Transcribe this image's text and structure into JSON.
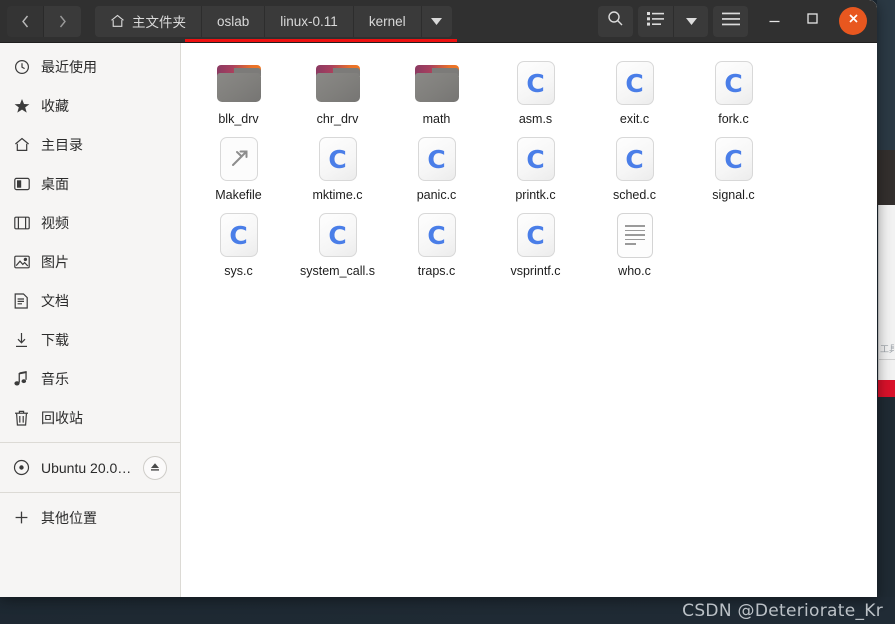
{
  "window": {
    "titlebar": {
      "back_label": "后退",
      "forward_label": "前进",
      "path_buttons": [
        {
          "label": "主文件夹",
          "icon": "home-icon",
          "has_home_icon": true
        },
        {
          "label": "oslab",
          "icon": "",
          "has_home_icon": false
        },
        {
          "label": "linux-0.11",
          "icon": "",
          "has_home_icon": false
        },
        {
          "label": "kernel",
          "icon": "",
          "has_home_icon": false
        }
      ],
      "path_dropdown_icon": "chevron-down-icon",
      "actions": [
        {
          "name": "search-button",
          "icon": "search-icon",
          "label": "搜索"
        },
        {
          "name": "view-list-button",
          "icon": "list-view-icon",
          "label": "列表视图"
        },
        {
          "name": "view-options-button",
          "icon": "chevron-down-icon",
          "label": "视图选项"
        },
        {
          "name": "menu-button",
          "icon": "hamburger-icon",
          "label": "菜单"
        }
      ],
      "window_controls": [
        {
          "name": "minimize-button",
          "icon": "minimize-icon",
          "label": "最小化"
        },
        {
          "name": "maximize-button",
          "icon": "maximize-icon",
          "label": "最大化"
        },
        {
          "name": "close-button",
          "icon": "close-icon",
          "label": "关闭"
        }
      ],
      "close_button_color": "#e8571f",
      "background_color": "#303030"
    },
    "annotation": {
      "type": "underline",
      "color": "#ee1111"
    }
  },
  "sidebar": {
    "background_color": "#f6f5f4",
    "items": [
      {
        "label": "最近使用",
        "icon": "clock-icon",
        "type": "place"
      },
      {
        "label": "收藏",
        "icon": "star-icon",
        "type": "place"
      },
      {
        "label": "主目录",
        "icon": "home-icon",
        "type": "place"
      },
      {
        "label": "桌面",
        "icon": "desktop-icon",
        "type": "place"
      },
      {
        "label": "视频",
        "icon": "film-icon",
        "type": "place"
      },
      {
        "label": "图片",
        "icon": "image-icon",
        "type": "place"
      },
      {
        "label": "文档",
        "icon": "document-icon",
        "type": "place"
      },
      {
        "label": "下载",
        "icon": "download-icon",
        "type": "place"
      },
      {
        "label": "音乐",
        "icon": "music-icon",
        "type": "place"
      },
      {
        "label": "回收站",
        "icon": "trash-icon",
        "type": "place"
      }
    ],
    "devices": [
      {
        "label": "Ubuntu 20.0…",
        "icon": "disc-icon",
        "eject_icon": "eject-icon",
        "type": "volume"
      }
    ],
    "network": [
      {
        "label": "其他位置",
        "icon": "plus-icon",
        "type": "network"
      }
    ]
  },
  "content": {
    "files": [
      {
        "name": "blk_drv",
        "kind": "folder"
      },
      {
        "name": "chr_drv",
        "kind": "folder"
      },
      {
        "name": "math",
        "kind": "folder"
      },
      {
        "name": "asm.s",
        "kind": "c-source"
      },
      {
        "name": "exit.c",
        "kind": "c-source"
      },
      {
        "name": "fork.c",
        "kind": "c-source"
      },
      {
        "name": "Makefile",
        "kind": "makefile"
      },
      {
        "name": "mktime.c",
        "kind": "c-source"
      },
      {
        "name": "panic.c",
        "kind": "c-source"
      },
      {
        "name": "printk.c",
        "kind": "c-source"
      },
      {
        "name": "sched.c",
        "kind": "c-source"
      },
      {
        "name": "signal.c",
        "kind": "c-source"
      },
      {
        "name": "sys.c",
        "kind": "c-source"
      },
      {
        "name": "system_call.s",
        "kind": "c-source"
      },
      {
        "name": "traps.c",
        "kind": "c-source"
      },
      {
        "name": "vsprintf.c",
        "kind": "c-source"
      },
      {
        "name": "who.c",
        "kind": "text"
      }
    ]
  },
  "background": {
    "side_panel_text": "工具",
    "desktop_color": "#202b35"
  },
  "watermark": {
    "text": "CSDN @Deteriorate_Kr"
  }
}
